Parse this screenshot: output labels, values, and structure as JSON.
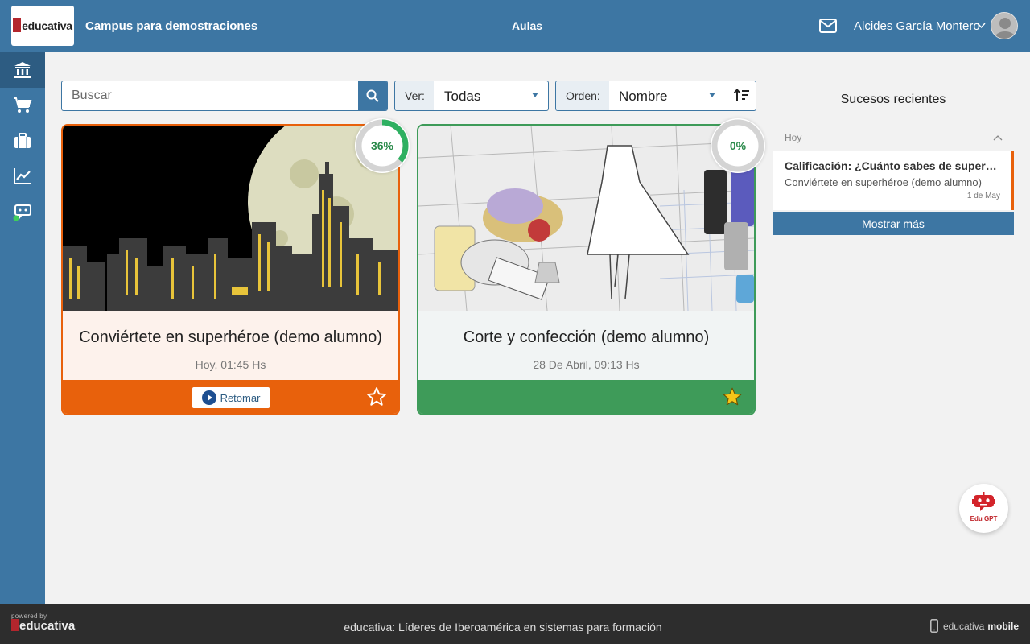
{
  "header": {
    "logo_text": "educativa",
    "campus": "Campus para demostraciones",
    "section": "Aulas",
    "user_name": "Alcides García Montero",
    "icons": [
      "mail-icon",
      "chevron-down-icon"
    ]
  },
  "sidebar": {
    "items": [
      {
        "name": "aulas",
        "icon": "bank-icon",
        "active": true
      },
      {
        "name": "tienda",
        "icon": "cart-icon",
        "active": false
      },
      {
        "name": "maletin",
        "icon": "briefcase-icon",
        "active": false
      },
      {
        "name": "estadisticas",
        "icon": "chart-icon",
        "active": false
      },
      {
        "name": "chat",
        "icon": "chat-bot-icon",
        "active": false
      }
    ]
  },
  "filters": {
    "search_placeholder": "Buscar",
    "ver_label": "Ver:",
    "ver_value": "Todas",
    "orden_label": "Orden:",
    "orden_value": "Nombre"
  },
  "courses": [
    {
      "title": "Conviértete en superhéroe (demo alumno)",
      "date": "Hoy, 01:45 Hs",
      "progress": "36%",
      "progress_fraction": 0.36,
      "action_label": "Retomar",
      "favorite": false,
      "color": "#e8610c"
    },
    {
      "title": "Corte y confección (demo alumno)",
      "date": "28 De Abril, 09:13 Hs",
      "progress": "0%",
      "progress_fraction": 0,
      "favorite": true,
      "color": "#3e9b59"
    }
  ],
  "events": {
    "title": "Sucesos recientes",
    "day": "Hoy",
    "items": [
      {
        "title": "Calificación: ¿Cuánto sabes de superhéroes?",
        "course": "Conviértete en superhéroe (demo alumno)",
        "date": "1 de May"
      }
    ],
    "more_label": "Mostrar más"
  },
  "edugpt_label": "Edu GPT",
  "footer": {
    "powered_small": "powered by",
    "powered_brand": "educativa",
    "tagline": "educativa: Líderes de Iberoamérica en sistemas para formación",
    "mobile_prefix": "educativa",
    "mobile_suffix": "mobile"
  },
  "colors": {
    "brand_blue": "#3d76a3",
    "orange": "#e8610c",
    "green": "#3e9b59",
    "logo_red": "#b3262d"
  }
}
